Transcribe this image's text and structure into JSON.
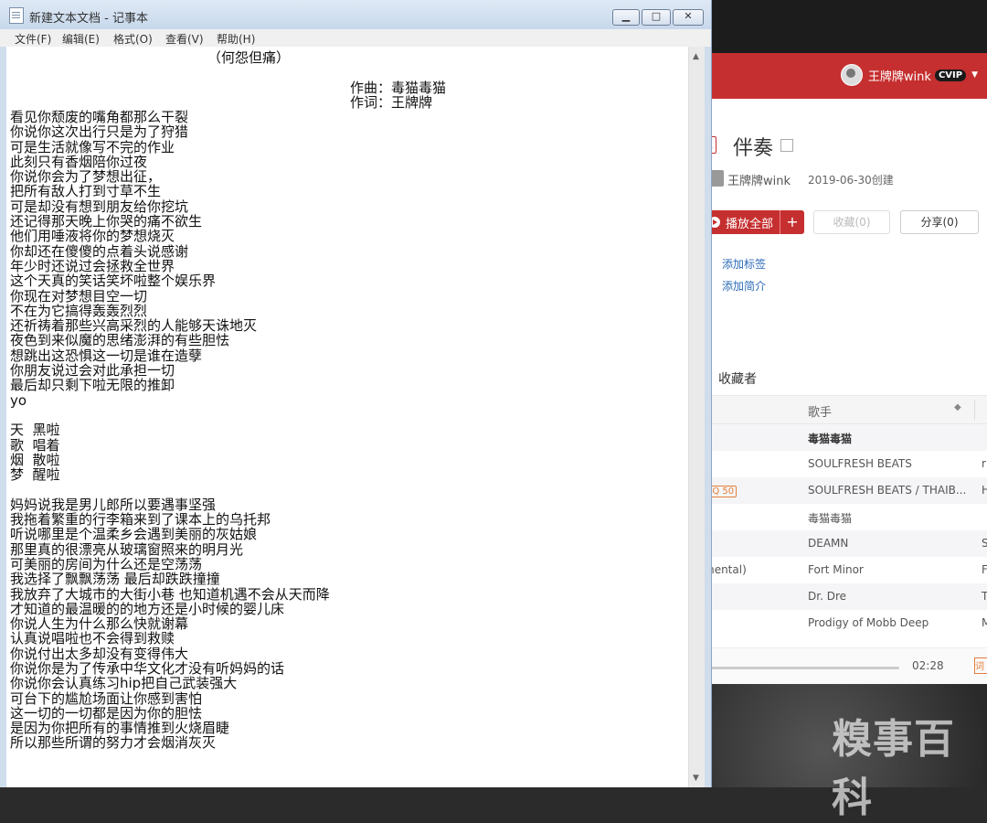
{
  "notepad": {
    "title": "新建文本文档 - 记事本",
    "window_buttons": {
      "minimize": "▁",
      "maximize": "□",
      "close": "✕"
    },
    "menu": [
      "文件(F)",
      "编辑(E)",
      "格式(O)",
      "查看(V)",
      "帮助(H)"
    ],
    "heading": "（何怨但痛）",
    "credits": [
      "作曲：毒猫毒猫",
      "作词：王牌牌"
    ],
    "lines": [
      "看见你颓废的嘴角都那么干裂",
      "你说你这次出行只是为了狩猎",
      "可是生活就像写不完的作业",
      "此刻只有香烟陪你过夜",
      "你说你会为了梦想出征，",
      "把所有敌人打到寸草不生",
      "可是却没有想到朋友给你挖坑",
      "还记得那天晚上你哭的痛不欲生",
      "他们用唾液将你的梦想烧灭",
      "你却还在傻傻的点着头说感谢",
      "年少时还说过会拯救全世界",
      "这个天真的笑话笑坏啦整个娱乐界",
      "你现在对梦想目空一切",
      "不在为它搞得轰轰烈烈",
      "还祈祷着那些兴高采烈的人能够天诛地灭",
      "夜色到来似魔的思绪澎湃的有些胆怯",
      "想跳出这恐惧这一切是谁在造孽",
      "你朋友说过会对此承担一切",
      "最后却只剩下啦无限的推卸",
      "yo",
      "",
      "天  黑啦",
      "歌  唱着",
      "烟  散啦",
      "梦  醒啦",
      "",
      "妈妈说我是男儿郎所以要遇事坚强",
      "我拖着繁重的行李箱来到了课本上的乌托邦",
      "听说哪里是个温柔乡会遇到美丽的灰姑娘",
      "那里真的很漂亮从玻璃窗照来的明月光",
      "可美丽的房间为什么还是空荡荡",
      "我选择了飘飘荡荡 最后却跌跌撞撞",
      "我放弃了大城市的大街小巷 也知道机遇不会从天而降",
      "才知道的最温暖的的地方还是小时候的婴儿床",
      "你说人生为什么那么快就谢幕",
      "认真说唱啦也不会得到救赎",
      "你说付出太多却没有变得伟大",
      "你说你是为了传承中华文化才没有听妈妈的话",
      "你说你会认真练习hip把自己武装强大",
      "可台下的尴尬场面让你感到害怕",
      "这一切的一切都是因为你的胆怯",
      "是因为你把所有的事情推到火烧眉睫",
      "所以那些所谓的努力才会烟消灰灭"
    ]
  },
  "music_app": {
    "user_name": "王牌牌wink",
    "vip_label": "CVIP",
    "playlist_tag": "单",
    "playlist_title": "伴奏",
    "creator_name": "王牌牌wink",
    "created_date": "2019-06-30创建",
    "play_all_label": "播放全部",
    "play_all_plus": "+",
    "collect_label": "收藏(0)",
    "share_label": "分享(0)",
    "tags_link": "添加标签",
    "intro_link": "添加简介",
    "collectors_tab": "收藏者",
    "column_artist": "歌手",
    "rows": [
      {
        "left": "",
        "artist": "毒猫毒猫",
        "more": ""
      },
      {
        "left": "",
        "artist": "SOULFRESH BEATS",
        "more": "r"
      },
      {
        "left": "SQ 50",
        "artist": "SOULFRESH BEATS / THAIB...",
        "more": "H"
      },
      {
        "left": "",
        "artist": "毒猫毒猫",
        "more": ""
      },
      {
        "left": "",
        "artist": "DEAMN",
        "more": "S"
      },
      {
        "left": "mental)",
        "artist": "Fort Minor",
        "more": "F"
      },
      {
        "left": ")",
        "artist": "Dr. Dre",
        "more": "T"
      },
      {
        "left": "",
        "artist": "Prodigy of Mobb Deep",
        "more": "M"
      }
    ],
    "time_total": "02:28",
    "lyric_btn": "词"
  },
  "watermark": "糗事百科",
  "colors": {
    "accent_red": "#c62f2f",
    "link_blue": "#2b6bb8"
  }
}
